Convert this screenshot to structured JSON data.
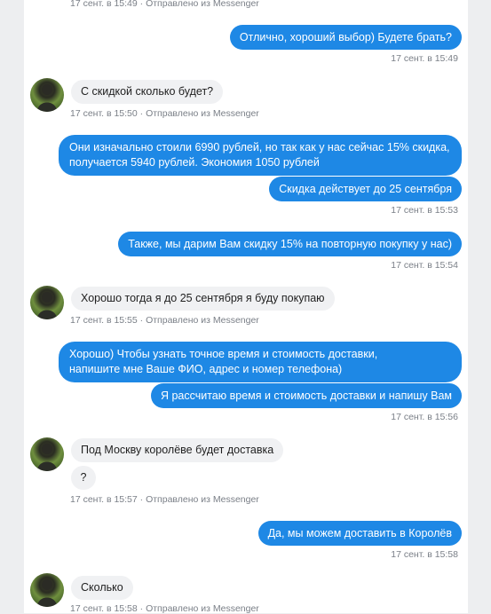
{
  "messages": [
    {
      "id": "m0",
      "meta": "17 сент. в 15:49 · Отправлено из Messenger"
    },
    {
      "id": "m1",
      "text": "Отлично, хороший выбор) Будете брать?",
      "meta": "17 сент. в 15:49"
    },
    {
      "id": "m2",
      "text": "С скидкой сколько будет?",
      "meta": "17 сент. в 15:50 · Отправлено из Messenger"
    },
    {
      "id": "m3",
      "text": "Они изначально стоили 6990 рублей, но так как у нас сейчас 15% скидка, получается 5940 рублей. Экономия 1050 рублей"
    },
    {
      "id": "m4",
      "text": "Скидка действует до 25 сентября",
      "meta": "17 сент. в 15:53"
    },
    {
      "id": "m5",
      "text": "Также, мы дарим Вам скидку 15% на повторную покупку у нас)",
      "meta": "17 сент. в 15:54"
    },
    {
      "id": "m6",
      "text": "Хорошо тогда я до 25 сентября я буду покупаю",
      "meta": "17 сент. в 15:55 · Отправлено из Messenger"
    },
    {
      "id": "m7",
      "text": "Хорошо) Чтобы узнать точное время и стоимость доставки, напишите мне Ваше ФИО, адрес и номер телефона)"
    },
    {
      "id": "m8",
      "text": "Я рассчитаю время и стоимость доставки и напишу Вам",
      "meta": "17 сент. в 15:56"
    },
    {
      "id": "m9",
      "text": "Под Москву королёве будет доставка"
    },
    {
      "id": "m10",
      "text": "?",
      "meta": "17 сент. в 15:57 · Отправлено из Messenger"
    },
    {
      "id": "m11",
      "text": "Да, мы можем доставить в Королёв",
      "meta": "17 сент. в 15:58"
    },
    {
      "id": "m12",
      "text": "Сколько",
      "meta": "17 сент. в 15:58 · Отправлено из Messenger"
    }
  ],
  "colors": {
    "outgoing": "#1e88e5",
    "incoming": "#f0f1f3",
    "meta": "#7a7f87"
  },
  "icons": {
    "avatar": "user-avatar-photo"
  }
}
